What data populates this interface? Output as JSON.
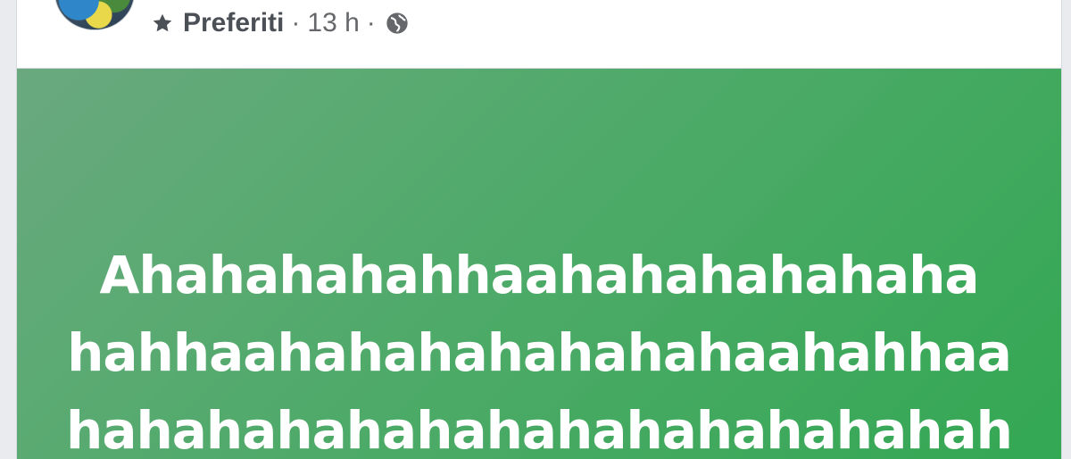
{
  "post": {
    "audience_label": "Preferiti",
    "separator": "·",
    "timestamp": "13 h",
    "icons": [
      "star-icon",
      "globe-icon"
    ],
    "background_gradient": [
      "#6aa97f",
      "#33a853"
    ],
    "text_color": "#ffffff",
    "text_lines": [
      "Ahahahahahhaahahahahahaha",
      "hahhaahahahahahahahaahahhaa",
      "hahahahahahahahahahahahahah"
    ]
  }
}
